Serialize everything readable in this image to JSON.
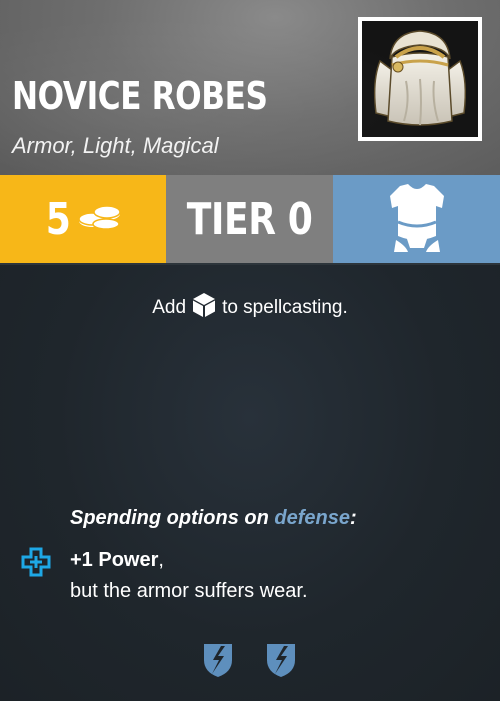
{
  "card": {
    "title": "NOVICE ROBES",
    "subtitle": "Armor, Light, Magical",
    "portrait_icon": "white-robe-armor-image"
  },
  "stats": {
    "cost": "5",
    "cost_icon": "coins-icon",
    "tier": "TIER 0",
    "type_icon": "armor-vest-icon",
    "colors": {
      "cost": "#f7b718",
      "tier": "#7f7f7f",
      "type": "#6b9bc6"
    }
  },
  "effect": {
    "prefix": "Add",
    "icon": "die-cube-icon",
    "suffix": "to spellcasting."
  },
  "spending": {
    "heading_prefix": "Spending options on ",
    "heading_keyword": "defense",
    "heading_suffix": ":",
    "keyword_color": "#7aa6cd",
    "option_icon": "plus-target-icon",
    "option_bold": "+1 Power",
    "option_comma": ",",
    "option_line2": "but the armor suffers wear."
  },
  "durability": {
    "count": 2,
    "icon": "broken-shield-icon"
  }
}
